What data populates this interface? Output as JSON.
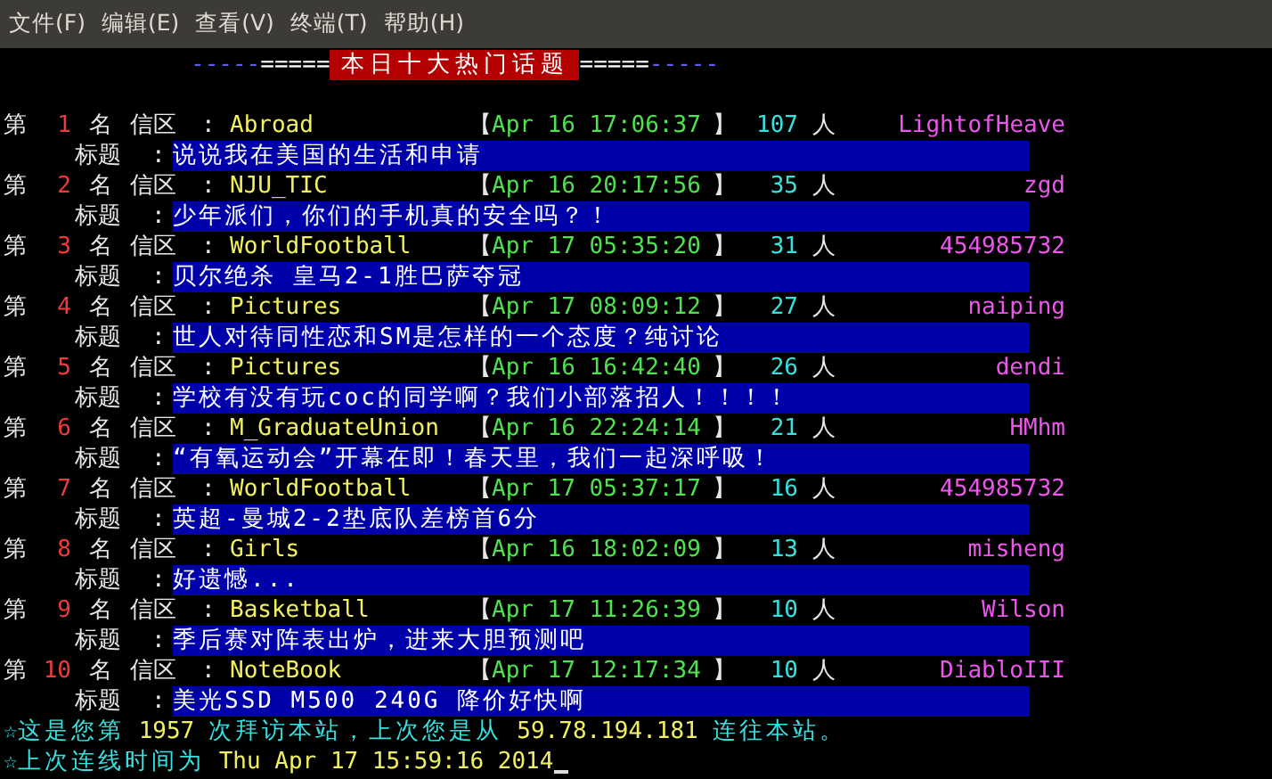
{
  "menu": [
    {
      "label": "文件(F)"
    },
    {
      "label": "编辑(E)"
    },
    {
      "label": "查看(V)"
    },
    {
      "label": "终端(T)"
    },
    {
      "label": "帮助(H)"
    }
  ],
  "header": {
    "left_dashes": "-----",
    "left_equals": "=====",
    "title": "本日十大热门话题",
    "right_equals": "=====",
    "right_dashes": "-----"
  },
  "topics": [
    {
      "rank_prefix": "第",
      "rank": "1",
      "rank_suffix": "名",
      "board_label": "信区",
      "separator": ":",
      "board": "Abroad",
      "open_bracket": "【",
      "time": "Apr 16 17:06:37",
      "close_bracket": "】",
      "count": "107",
      "count_unit": "人",
      "user": "LightofHeave",
      "title_label": "标题",
      "title_separator": ":",
      "title": "说说我在美国的生活和申请"
    },
    {
      "rank_prefix": "第",
      "rank": "2",
      "rank_suffix": "名",
      "board_label": "信区",
      "separator": ":",
      "board": "NJU_TIC",
      "open_bracket": "【",
      "time": "Apr 16 20:17:56",
      "close_bracket": "】",
      "count": "35",
      "count_unit": "人",
      "user": "zgd",
      "title_label": "标题",
      "title_separator": ":",
      "title": "少年派们，你们的手机真的安全吗？！"
    },
    {
      "rank_prefix": "第",
      "rank": "3",
      "rank_suffix": "名",
      "board_label": "信区",
      "separator": ":",
      "board": "WorldFootball",
      "open_bracket": "【",
      "time": "Apr 17 05:35:20",
      "close_bracket": "】",
      "count": "31",
      "count_unit": "人",
      "user": "454985732",
      "title_label": "标题",
      "title_separator": ":",
      "title": "贝尔绝杀 皇马2-1胜巴萨夺冠"
    },
    {
      "rank_prefix": "第",
      "rank": "4",
      "rank_suffix": "名",
      "board_label": "信区",
      "separator": ":",
      "board": "Pictures",
      "open_bracket": "【",
      "time": "Apr 17 08:09:12",
      "close_bracket": "】",
      "count": "27",
      "count_unit": "人",
      "user": "naiping",
      "title_label": "标题",
      "title_separator": ":",
      "title": "世人对待同性恋和SM是怎样的一个态度？纯讨论"
    },
    {
      "rank_prefix": "第",
      "rank": "5",
      "rank_suffix": "名",
      "board_label": "信区",
      "separator": ":",
      "board": "Pictures",
      "open_bracket": "【",
      "time": "Apr 16 16:42:40",
      "close_bracket": "】",
      "count": "26",
      "count_unit": "人",
      "user": "dendi",
      "title_label": "标题",
      "title_separator": ":",
      "title": "学校有没有玩coc的同学啊？我们小部落招人！！！！"
    },
    {
      "rank_prefix": "第",
      "rank": "6",
      "rank_suffix": "名",
      "board_label": "信区",
      "separator": ":",
      "board": "M_GraduateUnion",
      "open_bracket": "【",
      "time": "Apr 16 22:24:14",
      "close_bracket": "】",
      "count": "21",
      "count_unit": "人",
      "user": "HMhm",
      "title_label": "标题",
      "title_separator": ":",
      "title": "“有氧运动会”开幕在即！春天里，我们一起深呼吸！"
    },
    {
      "rank_prefix": "第",
      "rank": "7",
      "rank_suffix": "名",
      "board_label": "信区",
      "separator": ":",
      "board": "WorldFootball",
      "open_bracket": "【",
      "time": "Apr 17 05:37:17",
      "close_bracket": "】",
      "count": "16",
      "count_unit": "人",
      "user": "454985732",
      "title_label": "标题",
      "title_separator": ":",
      "title": "英超-曼城2-2垫底队差榜首6分"
    },
    {
      "rank_prefix": "第",
      "rank": "8",
      "rank_suffix": "名",
      "board_label": "信区",
      "separator": ":",
      "board": "Girls",
      "open_bracket": "【",
      "time": "Apr 16 18:02:09",
      "close_bracket": "】",
      "count": "13",
      "count_unit": "人",
      "user": "misheng",
      "title_label": "标题",
      "title_separator": ":",
      "title": "好遗憾..."
    },
    {
      "rank_prefix": "第",
      "rank": "9",
      "rank_suffix": "名",
      "board_label": "信区",
      "separator": ":",
      "board": "Basketball",
      "open_bracket": "【",
      "time": "Apr 17 11:26:39",
      "close_bracket": "】",
      "count": "10",
      "count_unit": "人",
      "user": "Wilson",
      "title_label": "标题",
      "title_separator": ":",
      "title": "季后赛对阵表出炉，进来大胆预测吧"
    },
    {
      "rank_prefix": "第",
      "rank": "10",
      "rank_suffix": "名",
      "board_label": "信区",
      "separator": ":",
      "board": "NoteBook",
      "open_bracket": "【",
      "time": "Apr 17 12:17:34",
      "close_bracket": "】",
      "count": "10",
      "count_unit": "人",
      "user": "DiabloIII",
      "title_label": "标题",
      "title_separator": ":",
      "title": "美光SSD M500 240G 降价好快啊"
    }
  ],
  "footer": [
    {
      "star": "☆",
      "parts": [
        {
          "kind": "plain",
          "text": "这是您第"
        },
        {
          "kind": "value",
          "text": "1957"
        },
        {
          "kind": "plain",
          "text": "次拜访本站，上次您是从"
        },
        {
          "kind": "value",
          "text": "59.78.194.181"
        },
        {
          "kind": "plain",
          "text": "连往本站。"
        }
      ]
    },
    {
      "star": "☆",
      "parts": [
        {
          "kind": "plain",
          "text": "上次连线时间为"
        },
        {
          "kind": "value",
          "text": "Thu Apr 17 15:59:16 2014"
        }
      ],
      "cursor": true
    }
  ]
}
